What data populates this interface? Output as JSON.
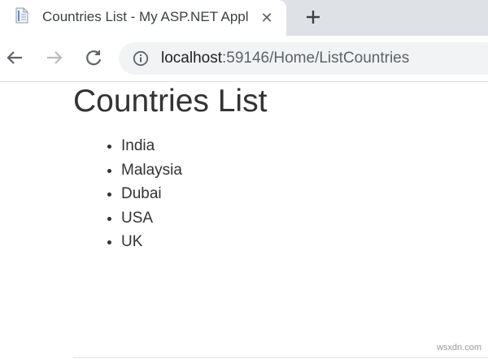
{
  "browser": {
    "tab": {
      "title": "Countries List - My ASP.NET Appl",
      "icon": "page-icon",
      "close_icon": "close-icon"
    },
    "new_tab_icon": "plus-icon",
    "toolbar": {
      "back_icon": "arrow-left-icon",
      "forward_icon": "arrow-right-icon",
      "reload_icon": "reload-icon",
      "info_icon": "info-icon"
    },
    "address": {
      "host": "localhost",
      "path": ":59146/Home/ListCountries"
    }
  },
  "page": {
    "title": "Countries List",
    "countries": [
      "India",
      "Malaysia",
      "Dubai",
      "USA",
      "UK"
    ]
  },
  "watermark": "wsxdn.com",
  "colors": {
    "tabstrip": "#dee1e6",
    "omnibox": "#f1f3f4",
    "text": "#333333"
  }
}
